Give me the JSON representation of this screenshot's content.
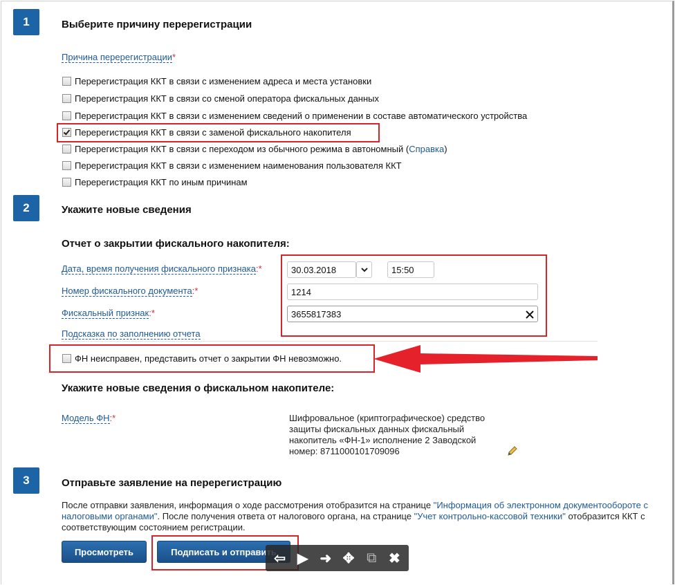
{
  "section1": {
    "number": "1",
    "title": "Выберите причину перерегистрации",
    "field_label": "Причина перерегистрации",
    "required_mark": "*",
    "options": [
      {
        "label": "Перерегистрация ККТ в связи с изменением адреса и места установки",
        "checked": false
      },
      {
        "label": "Перерегистрация ККТ в связи со сменой оператора фискальных данных",
        "checked": false
      },
      {
        "label": "Перерегистрация ККТ в связи с изменением сведений о применении в составе автоматического устройства",
        "checked": false
      },
      {
        "label": "Перерегистрация ККТ в связи с заменой фискального накопителя",
        "checked": true
      },
      {
        "label": "Перерегистрация ККТ в связи с переходом из обычного режима в автономный (",
        "link": "Справка",
        "suffix": ")",
        "checked": false
      },
      {
        "label": "Перерегистрация ККТ в связи с изменением наименования пользователя ККТ",
        "checked": false
      },
      {
        "label": "Перерегистрация ККТ по иным причинам",
        "checked": false
      }
    ]
  },
  "section2": {
    "number": "2",
    "title": "Укажите новые сведения",
    "report_title": "Отчет о закрытии фискального накопителя:",
    "date_label": "Дата, время получения фискального признака",
    "date_req": ":*",
    "date_value": "30.03.2018",
    "time_value": "15:50",
    "doc_label": "Номер фискального документа",
    "doc_req": ":*",
    "doc_value": "1214",
    "sign_label": "Фискальный признак",
    "sign_req": ":*",
    "sign_value": "3655817383",
    "hint_link": "Подсказка по заполнению отчета",
    "fn_broken_label": "ФН неисправен, представить отчет о закрытии ФН невозможно.",
    "fn_title": "Укажите новые сведения о фискальном накопителе:",
    "model_label": "Модель ФН",
    "model_req": ":*",
    "model_value_lines": [
      "Шифровальное (криптографическое) средство",
      "защиты фискальных данных фискальный",
      "накопитель «ФН-1» исполнение 2 Заводской",
      "номер: 8711000101709096"
    ]
  },
  "section3": {
    "number": "3",
    "title": "Отправьте заявление на перерегистрацию",
    "text1": "После отправки заявления, информация о ходе рассмотрения отобразится на странице ",
    "link1": "\"Информация об электронном документообороте с налоговыми органами\"",
    "text2": ". После получения ответа от налогового органа, на странице ",
    "link2": "\"Учет контрольно-кассовой техники\"",
    "text3": " отобразится ККТ с соответствующим состоянием регистрации.",
    "preview_button": "Просмотреть",
    "sign_button": "Подписать и отправить"
  },
  "colors": {
    "accent": "#1d64a7",
    "highlight": "#d6242b",
    "link": "#1f5a94"
  },
  "toolbar_icons": [
    "arrow-left-icon",
    "play-icon",
    "arrow-right-icon",
    "move-icon",
    "popout-icon",
    "close-icon"
  ]
}
